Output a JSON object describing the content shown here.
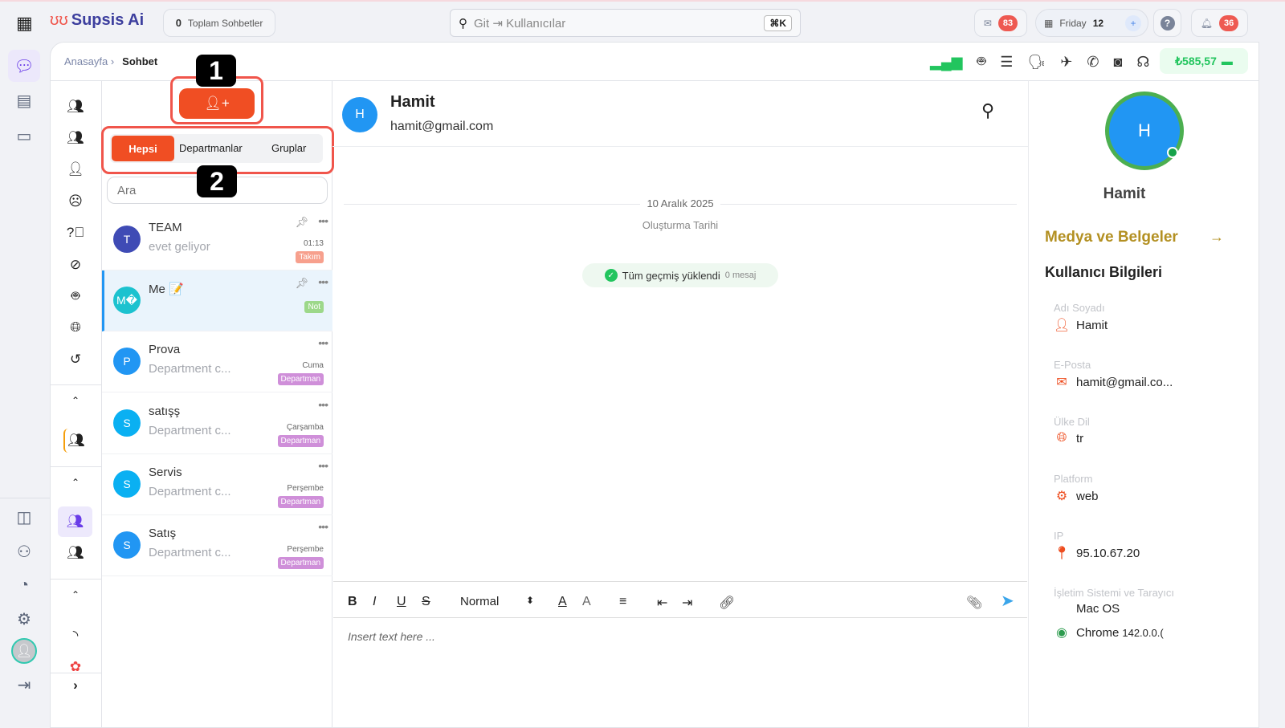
{
  "topbar": {
    "logo": "Supsis Ai",
    "total_count": "0",
    "total_label": "Toplam Sohbetler",
    "search_placeholder": "Git ⇥ Kullanıcılar",
    "shortcut": "⌘K",
    "mail_badge": "83",
    "day": "Friday",
    "date": "12",
    "notif_badge": "36"
  },
  "header": {
    "breadcrumb_home": "Anasayfa ›",
    "breadcrumb_current": "Sohbet",
    "balance": "₺585,57"
  },
  "list": {
    "tabs": [
      "Hepsi",
      "Departmanlar",
      "Gruplar"
    ],
    "search_placeholder": "Ara",
    "markers": [
      "1",
      "2"
    ],
    "items": [
      {
        "initial": "T",
        "name": "TEAM",
        "preview": "evet geliyor",
        "time": "01:13",
        "tag": "Takım",
        "color": "#3f4bb5",
        "tag_color": "#f7a08d"
      },
      {
        "initial": "M�",
        "name": "Me 📝",
        "preview": "",
        "time": "",
        "tag": "Not",
        "color": "#1cc2cf",
        "tag_color": "#9dd88a"
      },
      {
        "initial": "P",
        "name": "Prova",
        "preview": "Department c...",
        "time": "Cuma",
        "tag": "Departman",
        "color": "#2196f3",
        "tag_color": "#cf8fd9"
      },
      {
        "initial": "S",
        "name": "satışş",
        "preview": "Department c...",
        "time": "Çarşamba",
        "tag": "Departman",
        "color": "#0ab0f2",
        "tag_color": "#cf8fd9"
      },
      {
        "initial": "S",
        "name": "Servis",
        "preview": "Department c...",
        "time": "Perşembe",
        "tag": "Departman",
        "color": "#0ab0f2",
        "tag_color": "#cf8fd9"
      },
      {
        "initial": "S",
        "name": "Satış",
        "preview": "Department c...",
        "time": "Perşembe",
        "tag": "Departman",
        "color": "#2196f3",
        "tag_color": "#cf8fd9"
      }
    ]
  },
  "chat": {
    "initial": "H",
    "name": "Hamit",
    "email": "hamit@gmail.com",
    "date": "10 Aralık 2025",
    "date_label": "Oluşturma Tarihi",
    "history": "Tüm geçmiş yüklendi",
    "history_count": "0 mesaj",
    "format": "Normal",
    "placeholder": "Insert text here ..."
  },
  "profile": {
    "initial": "H",
    "name": "Hamit",
    "media": "Medya ve Belgeler",
    "info_title": "Kullanıcı Bilgileri",
    "fields": [
      {
        "label": "Adı Soyadı",
        "value": "Hamit"
      },
      {
        "label": "E-Posta",
        "value": "hamit@gmail.co..."
      },
      {
        "label": "Ülke Dil",
        "value": "tr"
      },
      {
        "label": "Platform",
        "value": "web"
      },
      {
        "label": "IP",
        "value": "95.10.67.20"
      },
      {
        "label": "İşletim Sistemi ve Tarayıcı",
        "value": "Mac OS"
      }
    ],
    "browser": "Chrome",
    "browser_version": "142.0.0.("
  },
  "colors": {
    "accent": "#f04e23",
    "primary": "#2196f3",
    "green": "#22c55e"
  }
}
